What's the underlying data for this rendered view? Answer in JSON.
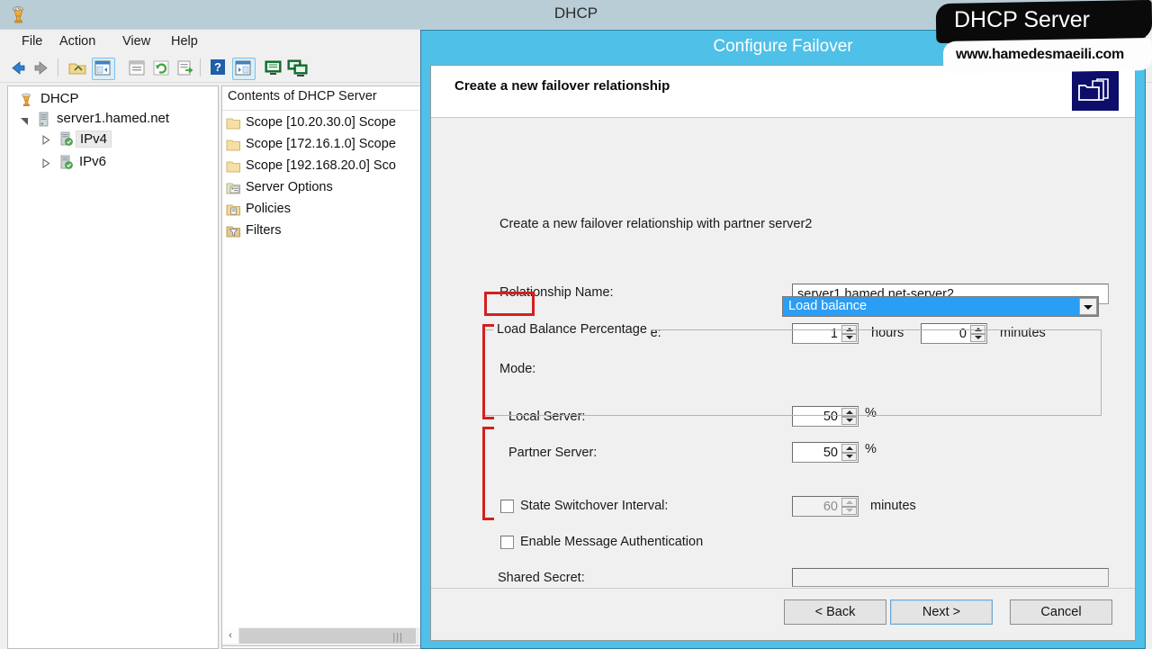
{
  "mmc": {
    "title": "DHCP",
    "app_icon": "dhcp-server-icon",
    "menu": [
      {
        "label": "File"
      },
      {
        "label": "Action"
      },
      {
        "label": "View"
      },
      {
        "label": "Help"
      }
    ],
    "toolbar": [
      {
        "name": "back-icon",
        "selected": false
      },
      {
        "name": "forward-icon",
        "selected": false
      },
      {
        "name": "up-folder-icon",
        "selected": false
      },
      {
        "name": "show-hide-tree-icon",
        "selected": true
      },
      {
        "name": "properties-icon",
        "selected": false
      },
      {
        "name": "refresh-icon",
        "selected": false
      },
      {
        "name": "export-list-icon",
        "selected": false
      },
      {
        "name": "help-icon",
        "selected": false
      },
      {
        "name": "show-action-pane-icon",
        "selected": true
      },
      {
        "name": "new-window-icon",
        "selected": false
      },
      {
        "name": "add-server-icon",
        "selected": false
      }
    ],
    "tree": [
      {
        "label": "DHCP",
        "icon": "dhcp-root-icon",
        "indent": 0,
        "expander": "",
        "selected": false
      },
      {
        "label": "server1.hamed.net",
        "icon": "server-icon",
        "indent": 1,
        "expander": "collapse",
        "selected": false
      },
      {
        "label": "IPv4",
        "icon": "ipv4-node-icon",
        "indent": 2,
        "expander": "expand",
        "selected": true
      },
      {
        "label": "IPv6",
        "icon": "ipv6-node-icon",
        "indent": 2,
        "expander": "expand",
        "selected": false
      }
    ],
    "list_header": "Contents of DHCP Server",
    "list_items": [
      {
        "label": "Scope [10.20.30.0] Scope",
        "icon": "folder-icon"
      },
      {
        "label": "Scope [172.16.1.0] Scope",
        "icon": "folder-icon"
      },
      {
        "label": "Scope [192.168.20.0] Sco",
        "icon": "folder-icon"
      },
      {
        "label": "Server Options",
        "icon": "server-options-icon"
      },
      {
        "label": "Policies",
        "icon": "policies-icon"
      },
      {
        "label": "Filters",
        "icon": "filters-icon"
      }
    ],
    "hscroll": {
      "left_arrow": "‹",
      "grip": "‖‖"
    }
  },
  "wizard": {
    "caption": "Configure Failover",
    "header_title": "Create a new failover relationship",
    "header_icon": "failover-folders-icon",
    "intro": "Create a new failover relationship with partner server2",
    "fields": {
      "relationship_name_label": "Relationship Name:",
      "relationship_name_value": "server1.hamed.net-server2",
      "mclt_label": "Maximum Client Lead Time:",
      "mclt_hours_value": "1",
      "mclt_hours_unit": "hours",
      "mclt_minutes_value": "0",
      "mclt_minutes_unit": "minutes",
      "mode_label": "Mode:",
      "mode_value": "Load balance",
      "lb_group_title": "Load Balance Percentage",
      "local_server_label": "Local Server:",
      "local_server_value": "50",
      "local_server_unit": "%",
      "partner_server_label": "Partner Server:",
      "partner_server_value": "50",
      "partner_server_unit": "%",
      "state_switchover_label": "State Switchover Interval:",
      "state_switchover_value": "60",
      "state_switchover_unit": "minutes",
      "state_switchover_checked": false,
      "message_auth_label": "Enable Message Authentication",
      "message_auth_checked": false,
      "shared_secret_label": "Shared Secret:",
      "shared_secret_value": ""
    },
    "buttons": {
      "back": "< Back",
      "next": "Next >",
      "cancel": "Cancel"
    }
  },
  "watermark": {
    "title": "DHCP Server",
    "url": "www.hamedesmaeili.com"
  },
  "colors": {
    "dialog_accent": "#4fc0e8",
    "selection_blue": "#2a9df4",
    "annotation_red": "#d32020",
    "titlebar": "#b8cdd6",
    "banner_icon": "#0d0d6b"
  }
}
